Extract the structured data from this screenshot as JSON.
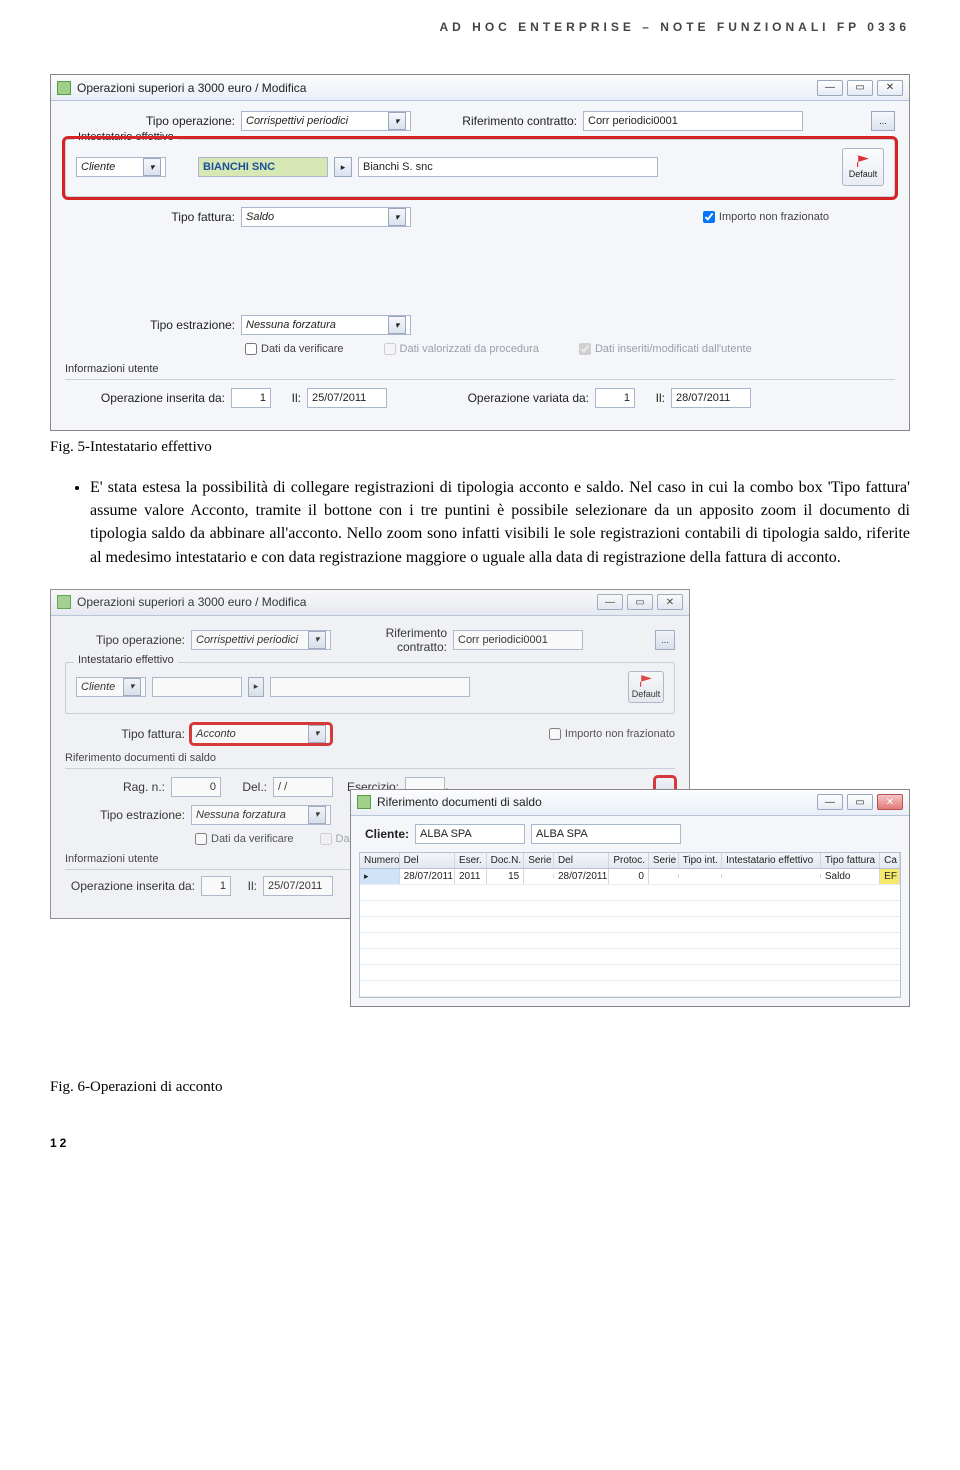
{
  "header": "AD HOC ENTERPRISE – NOTE FUNZIONALI FP 0336",
  "shot1": {
    "title": "Operazioni superiori a 3000 euro / Modifica",
    "tipo_operazione_lbl": "Tipo operazione:",
    "tipo_operazione_val": "Corrispettivi periodici",
    "rif_contratto_lbl": "Riferimento contratto:",
    "rif_contratto_val": "Corr periodici0001",
    "dots": "...",
    "group_title": "Intestatario effettivo",
    "cliente_val": "Cliente",
    "bianchi_code": "BIANCHI SNC",
    "bianchi_name": "Bianchi S. snc",
    "default_lbl": "Default",
    "tipo_fattura_lbl": "Tipo fattura:",
    "tipo_fattura_val": "Saldo",
    "importo_non_fraz": "Importo non frazionato",
    "tipo_estrazione_lbl": "Tipo estrazione:",
    "tipo_estrazione_val": "Nessuna forzatura",
    "dati_verificare": "Dati da verificare",
    "dati_valorizzati": "Dati valorizzati da procedura",
    "dati_utente": "Dati inseriti/modificati dall'utente",
    "info_utente": "Informazioni utente",
    "op_inserita_lbl": "Operazione inserita da:",
    "op_inserita_val": "1",
    "il_lbl": "Il:",
    "il_val1": "25/07/2011",
    "op_variata_lbl": "Operazione variata da:",
    "op_variata_val": "1",
    "il_val2": "28/07/2011"
  },
  "caption1": "Fig. 5-Intestatario effettivo",
  "bullets": [
    "E' stata estesa la possibilità di collegare registrazioni di tipologia acconto e saldo. Nel caso in cui la combo box 'Tipo fattura' assume valore Acconto, tramite il bottone con i tre puntini è possibile selezionare da un apposito zoom il documento di tipologia saldo da abbinare all'acconto. Nello zoom sono infatti visibili le sole registrazioni contabili di tipologia saldo, riferite al medesimo intestatario e con data registrazione maggiore o uguale alla data di registrazione della fattura di acconto."
  ],
  "shot2": {
    "title": "Operazioni superiori a 3000 euro / Modifica",
    "tipo_operazione_val": "Corrispettivi periodici",
    "rif_contratto_val": "Corr periodici0001",
    "cliente": "Cliente",
    "tipo_fattura_val": "Acconto",
    "importo_non_fraz": "Importo non frazionato",
    "rif_doc_saldo": "Riferimento documenti di saldo",
    "rag_n_lbl": "Rag. n.:",
    "rag_n_val": "0",
    "del_lbl": "Del.:",
    "del_val": "/ /",
    "esercizio_lbl": "Esercizio:",
    "tipo_estrazione_val": "Nessuna forzatura",
    "dati_verificare": "Dati da verificare",
    "op_inserita_val": "1",
    "il_val": "25/07/2011"
  },
  "shot3": {
    "title": "Riferimento documenti di saldo",
    "cliente_lbl": "Cliente:",
    "cliente_code": "ALBA SPA",
    "cliente_name": "ALBA SPA",
    "cols": [
      "Numero",
      "Del",
      "Eser.",
      "Doc.N.",
      "Serie",
      "Del",
      "Protoc.",
      "Serie",
      "Tipo int.",
      "Intestatario effettivo",
      "Tipo fattura",
      "Ca"
    ],
    "row": [
      "",
      "28/07/2011",
      "2011",
      "15",
      "",
      "28/07/2011",
      "0",
      "",
      "",
      "",
      "Saldo",
      "EF"
    ]
  },
  "caption2": "Fig. 6-Operazioni di acconto",
  "page_num": "12"
}
